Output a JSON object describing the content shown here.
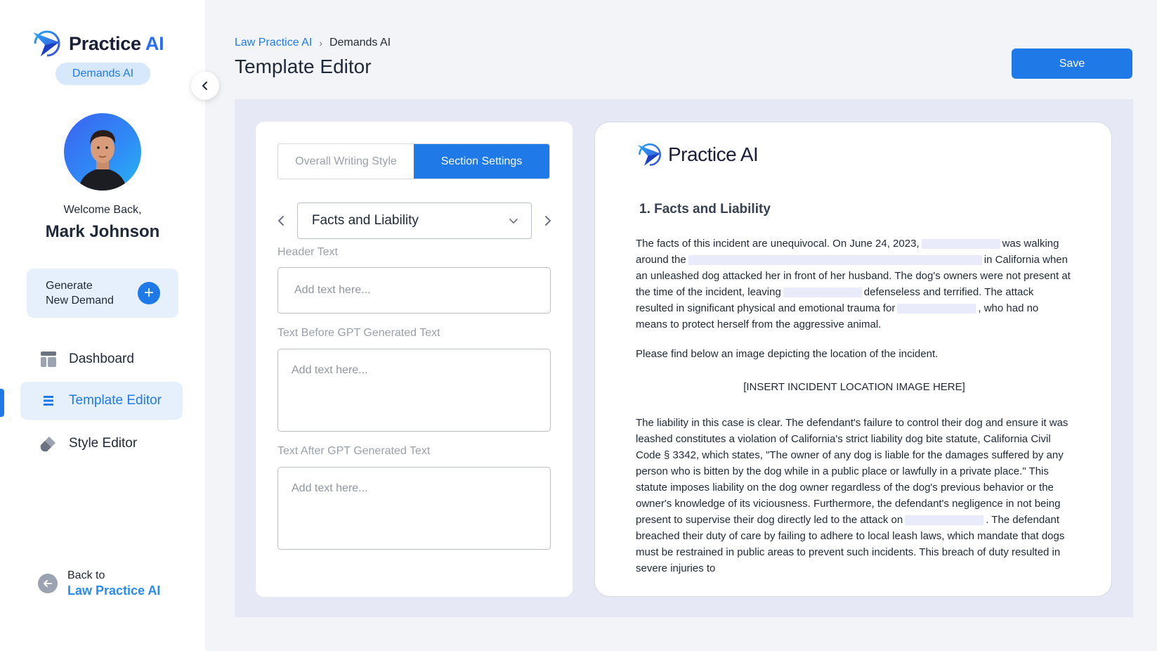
{
  "sidebar": {
    "logo_text": "Practice ",
    "logo_ai": "AI",
    "product_badge": "Demands AI",
    "welcome": "Welcome Back,",
    "user_name": "Mark Johnson",
    "generate_line1": "Generate",
    "generate_line2": "New Demand",
    "nav": [
      {
        "label": "Dashboard",
        "icon": "dashboard-icon"
      },
      {
        "label": "Template Editor",
        "icon": "list-icon",
        "active": true
      },
      {
        "label": "Style Editor",
        "icon": "brush-icon"
      }
    ],
    "back_line1": "Back to",
    "back_line2": "Law Practice AI"
  },
  "header": {
    "breadcrumb_root": "Law Practice AI",
    "breadcrumb_current": "Demands AI",
    "title": "Template Editor",
    "save_label": "Save"
  },
  "editor": {
    "tabs": [
      "Overall Writing Style",
      "Section Settings"
    ],
    "selected_tab": "Section Settings",
    "section_selected": "Facts and Liability",
    "fields": [
      {
        "label": "Header Text",
        "placeholder": "Add text here..."
      },
      {
        "label": "Text Before GPT Generated Text",
        "placeholder": "Add text here..."
      },
      {
        "label": "Text After GPT Generated Text",
        "placeholder": "Add text here..."
      }
    ]
  },
  "document": {
    "logo_text": "Practice AI",
    "heading": "1. Facts and Liability",
    "p1": {
      "a": "The facts of this incident are unequivocal. On June 24, 2023,",
      "b": "was walking around the",
      "c": "in California when an unleashed dog attacked her in front of her husband. The dog's owners were not present at the time of the incident, leaving",
      "d": "defenseless and terrified. The attack resulted in significant physical and emotional trauma for",
      "e": ", who had no means to protect herself from the aggressive animal."
    },
    "p2": "Please find below an image depicting the location of the incident.",
    "image_placeholder": "[INSERT INCIDENT LOCATION IMAGE HERE]",
    "p3": {
      "a": "The liability in this case is clear. The defendant's failure to control their dog and ensure it was leashed constitutes a violation of California's strict liability dog bite statute, California Civil Code § 3342, which states, \"The owner of any dog is liable for the damages suffered by any person who is bitten by the dog while in a public place or lawfully in a private place.\" This statute imposes liability on the dog owner regardless of the dog's previous behavior or the owner's knowledge of its viciousness. Furthermore, the defendant's negligence in not being present to supervise their dog directly led to the attack on",
      "b": ". The defendant breached their duty of care by failing to adhere to local leash laws, which mandate that dogs must be restrained in public areas to prevent such incidents. This breach of duty resulted in severe injuries to"
    }
  },
  "colors": {
    "accent": "#1f7ae8",
    "accent_light": "#e6f0fd",
    "workspace_bg": "#e6e9f5",
    "redaction": "#e9ebfb"
  }
}
